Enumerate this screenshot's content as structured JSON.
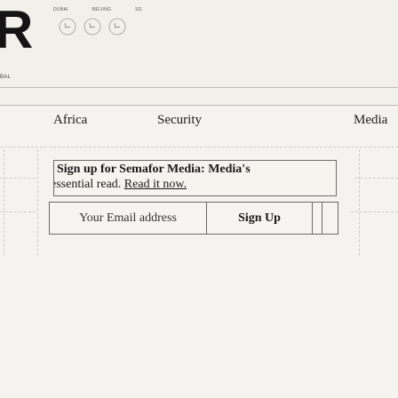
{
  "header": {
    "logo_letter": "R",
    "dial_labels": [
      "DUBAI",
      "BEIJING",
      "SG"
    ],
    "edition": "BAL"
  },
  "nav": {
    "items": [
      {
        "label": "Africa"
      },
      {
        "label": "Security"
      },
      {
        "label": "Media"
      }
    ]
  },
  "signup": {
    "title": "Sign up for Semafor Media: Media's",
    "body_prefix": "essential read. ",
    "body_link": "Read it now.",
    "email_placeholder": "Your Email address",
    "button_label": "Sign Up"
  }
}
